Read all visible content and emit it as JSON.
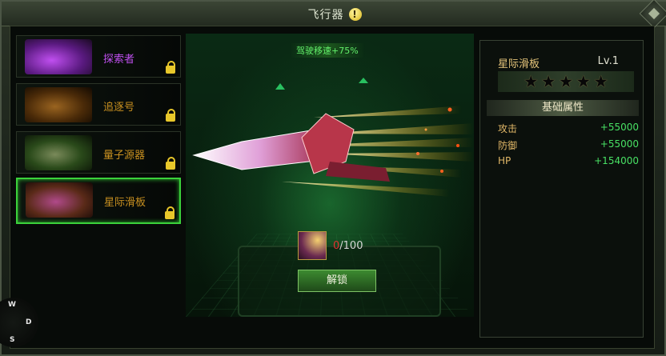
{
  "window": {
    "title": "飞行器",
    "title_icon": "info-icon",
    "close_icon": "close-icon"
  },
  "fleet": [
    {
      "name": "探索者",
      "color": "#b040e0",
      "selected": false,
      "locked": true
    },
    {
      "name": "追逐号",
      "color": "#c89020",
      "selected": false,
      "locked": true
    },
    {
      "name": "量子源器",
      "color": "#c89020",
      "selected": false,
      "locked": true
    },
    {
      "name": "星际滑板",
      "color": "#c89020",
      "selected": true,
      "locked": true
    }
  ],
  "stage": {
    "speed_bonus": "驾驶移速+75%"
  },
  "unlock": {
    "have": "0",
    "need": "/100",
    "button_label": "解锁"
  },
  "info": {
    "ship_name": "星际滑板",
    "level": "Lv.1",
    "stars_total": 5,
    "stars_filled": 0,
    "attributes_header": "基础属性",
    "attributes": [
      {
        "name": "攻击",
        "value": "+55000"
      },
      {
        "name": "防御",
        "value": "+55000"
      },
      {
        "name": "HP",
        "value": "+154000"
      }
    ]
  },
  "compass": {
    "north": "W",
    "east": "D",
    "south": "S"
  },
  "colors": {
    "accent_green": "#3bd23b",
    "gold": "#e4c47a",
    "value_green": "#48e064"
  }
}
